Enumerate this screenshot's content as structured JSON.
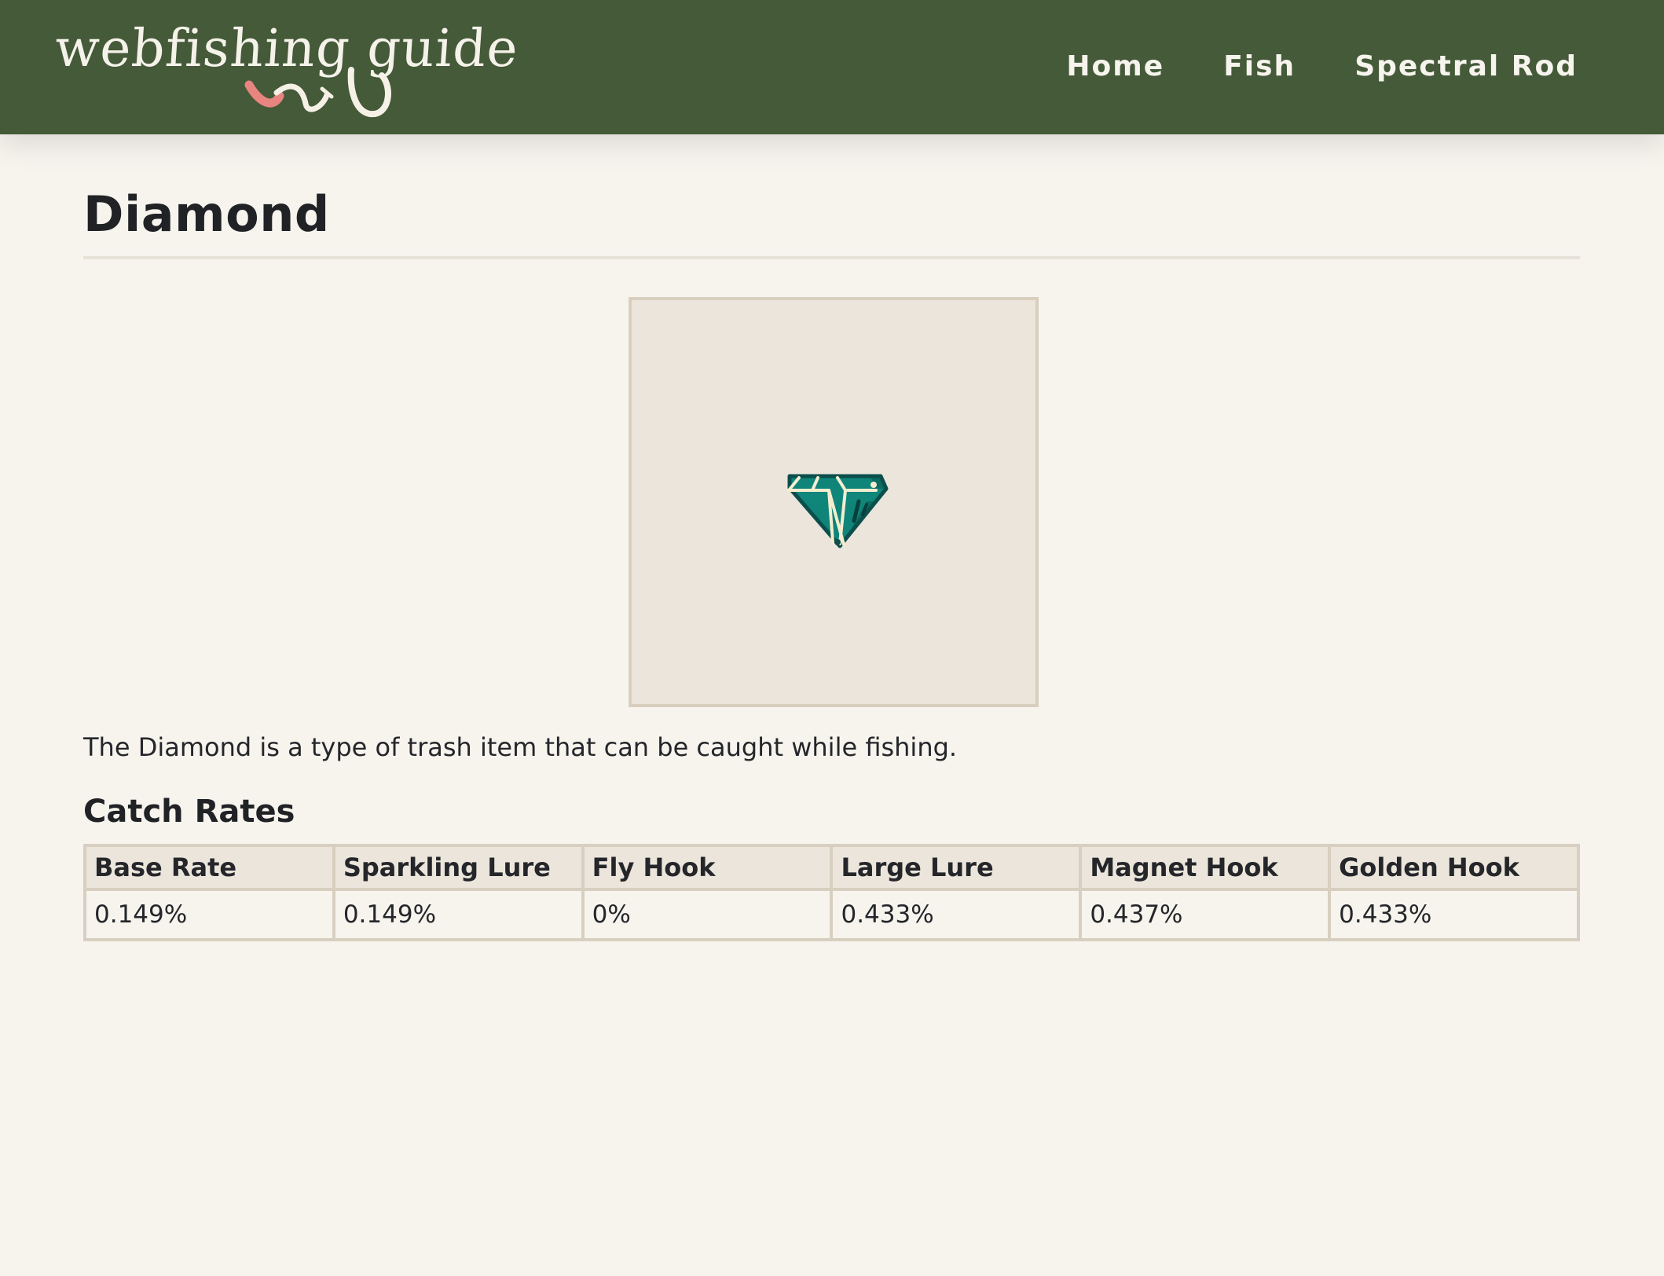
{
  "header": {
    "logo_text": "webfishing guide",
    "nav": [
      {
        "label": "Home"
      },
      {
        "label": "Fish"
      },
      {
        "label": "Spectral Rod"
      }
    ]
  },
  "page": {
    "title": "Diamond",
    "image_icon": "diamond-icon",
    "description": "The Diamond is a type of trash item that can be caught while fishing."
  },
  "catch_rates": {
    "title": "Catch Rates",
    "columns": [
      "Base Rate",
      "Sparkling Lure",
      "Fly Hook",
      "Large Lure",
      "Magnet Hook",
      "Golden Hook"
    ],
    "values": [
      "0.149%",
      "0.149%",
      "0%",
      "0.433%",
      "0.437%",
      "0.433%"
    ]
  },
  "colors": {
    "header_bg": "#445a38",
    "page_bg": "#f7f4ee",
    "panel_bg": "#ece5db",
    "border": "#d8cfc0",
    "diamond_teal": "#0f857a",
    "diamond_dark": "#0b4f4c"
  }
}
